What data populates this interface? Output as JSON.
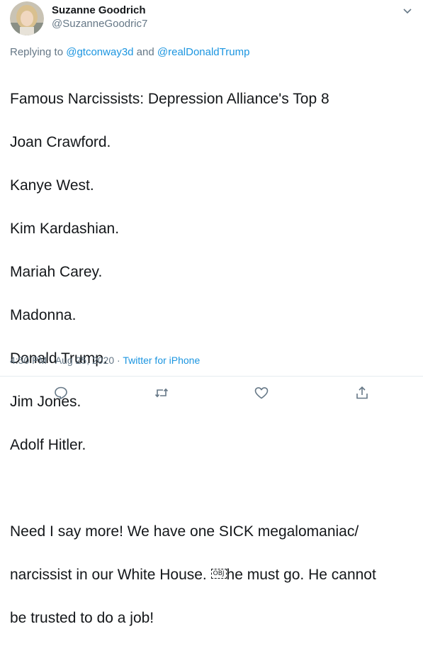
{
  "author": {
    "display_name": "Suzanne Goodrich",
    "handle": "@SuzanneGoodric7"
  },
  "reply": {
    "prefix": "Replying to ",
    "to1": "@gtconway3d",
    "and": " and ",
    "to2": "@realDonaldTrump"
  },
  "tweet": {
    "lines": [
      "Famous Narcissists: Depression Alliance's Top 8",
      "Joan Crawford.",
      "Kanye West.",
      "Kim Kardashian.",
      "Mariah Carey.",
      "Madonna.",
      "Donald Trump.",
      "Jim Jones.",
      "Adolf Hitler."
    ],
    "para2_line1": "Need I say more! We have one SICK megalomaniac/",
    "para2_line2_a": "narcissist in our White House. ",
    "obj_placeholder": "OBJ",
    "para2_line2_b": "he must go. He cannot",
    "para2_line3": "be trusted to do a job!"
  },
  "meta": {
    "time": "4:50 PM",
    "sep1": " · ",
    "date": "Aug 25, 2020",
    "sep2": " · ",
    "source": "Twitter for iPhone"
  },
  "icons": {
    "reply": "reply-icon",
    "retweet": "retweet-icon",
    "like": "like-icon",
    "share": "share-icon",
    "caret": "chevron-down-icon"
  },
  "colors": {
    "link": "#1b95e0",
    "secondary": "#657786",
    "text": "#14171a"
  }
}
